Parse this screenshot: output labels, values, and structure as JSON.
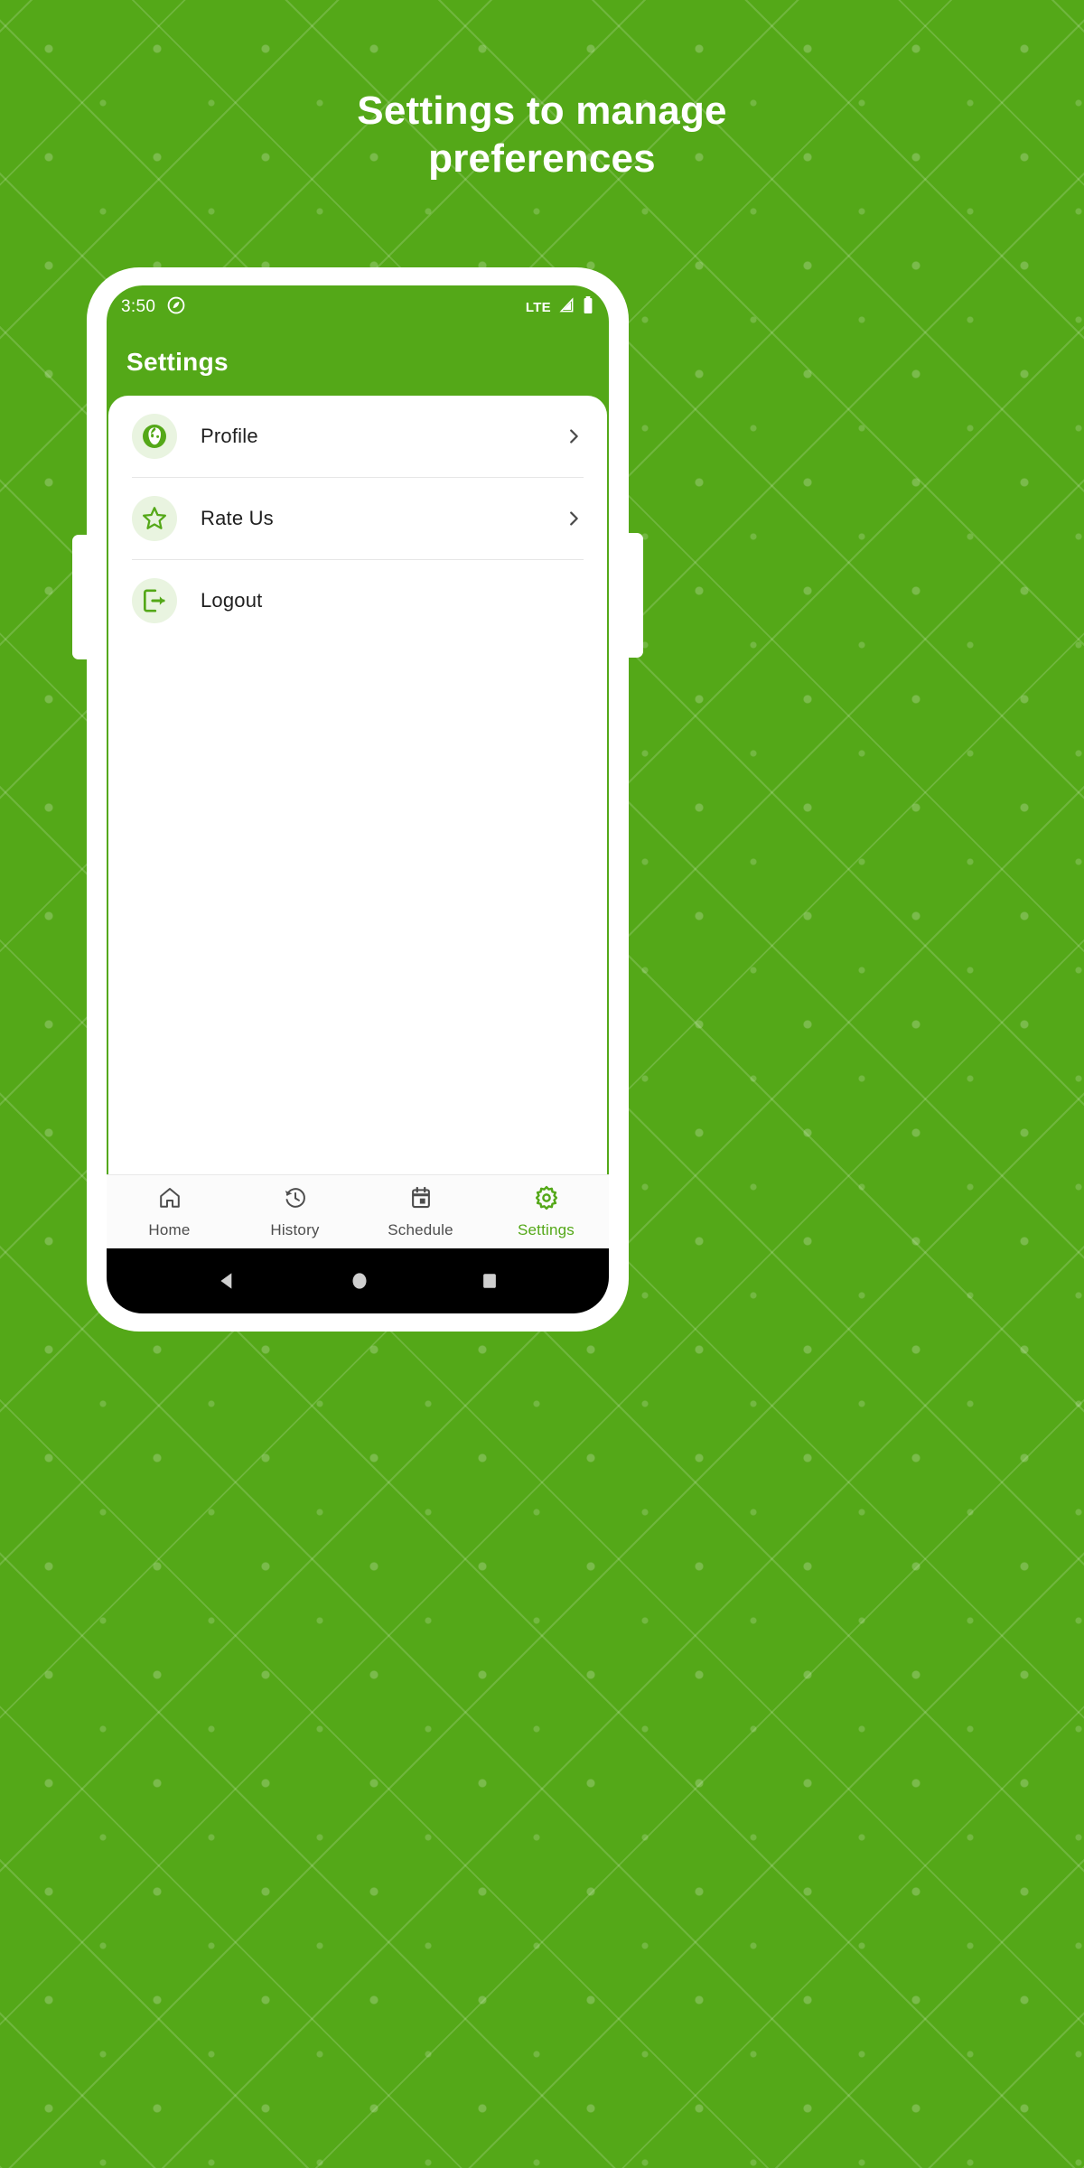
{
  "hero": {
    "line1": "Settings to manage",
    "line2": "preferences"
  },
  "colors": {
    "brand_green": "#54a818",
    "icon_bg": "#e9f4e0",
    "card_white": "#ffffff",
    "label_dark": "#1f1f1f",
    "nav_inactive": "#4d4d4d",
    "nav_active": "#54a818",
    "divider": "#e6e6e6",
    "sysnav_black": "#000000"
  },
  "statusbar": {
    "clock": "3:50",
    "left_icon": "privacy-indicator-icon",
    "network": "LTE",
    "signal_icon": "signal-triangle-icon",
    "battery_icon": "battery-full-icon"
  },
  "appbar": {
    "title": "Settings"
  },
  "settings_list": [
    {
      "label": "Profile",
      "icon": "user-profile-icon",
      "has_chevron": true
    },
    {
      "label": "Rate Us",
      "icon": "star-outline-icon",
      "has_chevron": true
    },
    {
      "label": "Logout",
      "icon": "logout-icon",
      "has_chevron": false
    }
  ],
  "bottom_nav": [
    {
      "label": "Home",
      "icon": "home-icon",
      "active": false
    },
    {
      "label": "History",
      "icon": "history-icon",
      "active": false
    },
    {
      "label": "Schedule",
      "icon": "calendar-icon",
      "active": false
    },
    {
      "label": "Settings",
      "icon": "gear-icon",
      "active": true
    }
  ],
  "system_nav": [
    {
      "icon": "back-triangle-icon"
    },
    {
      "icon": "home-circle-icon"
    },
    {
      "icon": "recents-square-icon"
    }
  ]
}
